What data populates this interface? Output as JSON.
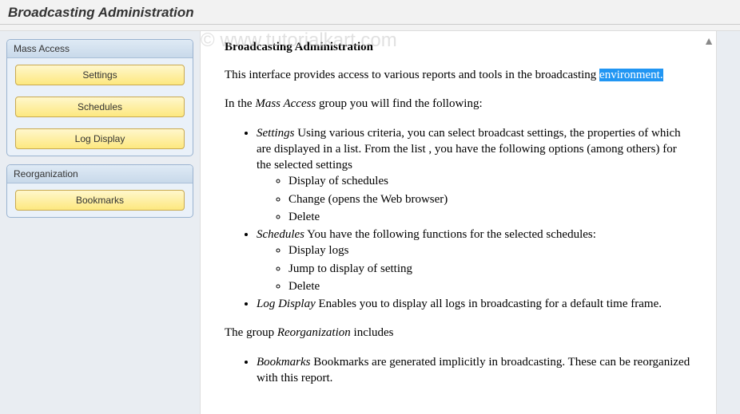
{
  "header": {
    "title": "Broadcasting Administration"
  },
  "watermark": "© www.tutorialkart.com",
  "sidebar": {
    "groups": [
      {
        "title": "Mass Access",
        "buttons": [
          {
            "label": "Settings"
          },
          {
            "label": "Schedules"
          },
          {
            "label": "Log Display"
          }
        ]
      },
      {
        "title": "Reorganization",
        "buttons": [
          {
            "label": "Bookmarks"
          }
        ]
      }
    ]
  },
  "content": {
    "heading": "Broadcasting Administration",
    "intro_pre": "This interface provides access to various reports and tools in the broadcasting ",
    "intro_highlight": "environment.",
    "mass_intro_pre": "In the ",
    "mass_intro_em": "Mass Access",
    "mass_intro_post": " group you will find the following:",
    "items": {
      "settings_em": "Settings",
      "settings_text": " Using various criteria, you can select broadcast settings, the properties of which are displayed in a list. From the list , you have the following options (among others) for the selected settings",
      "settings_sub": [
        "Display of schedules",
        "Change (opens the Web browser)",
        "Delete"
      ],
      "schedules_em": "Schedules",
      "schedules_text": " You have the following functions for the selected schedules:",
      "schedules_sub": [
        "Display logs",
        "Jump to display of setting",
        "Delete"
      ],
      "log_em": "Log Display",
      "log_text": " Enables you to display all logs in broadcasting for a default time frame."
    },
    "reorg_intro_pre": "The group ",
    "reorg_intro_em": "Reorganization",
    "reorg_intro_post": " includes",
    "reorg_items": {
      "bookmarks_em": "Bookmarks",
      "bookmarks_text": " Bookmarks are generated implicitly in broadcasting. These can be reorganized with this report."
    }
  }
}
